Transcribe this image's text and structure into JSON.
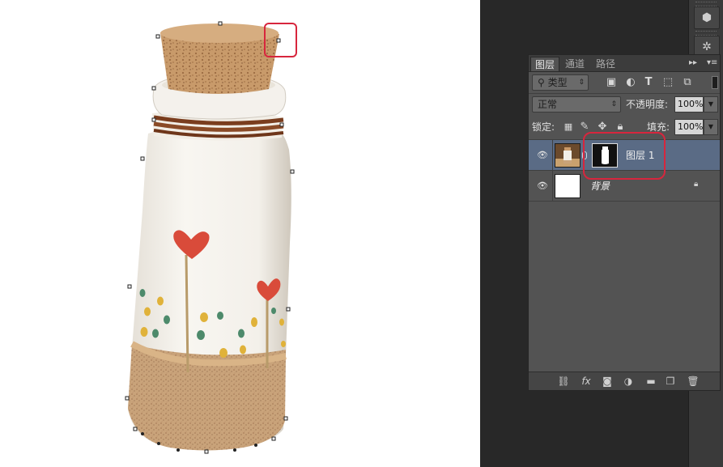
{
  "layers_panel": {
    "tabs": [
      {
        "label": "图层",
        "active": true
      },
      {
        "label": "通道",
        "active": false
      },
      {
        "label": "路径",
        "active": false
      }
    ],
    "filter": {
      "kind_label": "类型",
      "search_icon": "search-icon"
    },
    "filter_icons": [
      "image-filter-icon",
      "adjustment-filter-icon",
      "type-filter-icon",
      "shape-filter-icon",
      "smartobject-filter-icon"
    ],
    "blend_mode": "正常",
    "opacity_label": "不透明度:",
    "opacity_value": "100%",
    "lock_label": "锁定:",
    "fill_label": "填充:",
    "fill_value": "100%",
    "layers": [
      {
        "name": "图层 1",
        "selected": true,
        "has_mask": true
      },
      {
        "name": "背景",
        "selected": false,
        "locked": true
      }
    ],
    "footer_icons": [
      "link-icon",
      "fx-icon",
      "mask-icon",
      "adjustment-icon",
      "folder-icon",
      "new-layer-icon",
      "trash-icon"
    ],
    "fx_label": "fx"
  },
  "colors": {
    "selected_layer": "#5a6b85",
    "panel_bg": "#535353",
    "annotation_red": "#d7263d",
    "canvas_bg": "#ffffff",
    "workspace_bg": "#282828"
  }
}
